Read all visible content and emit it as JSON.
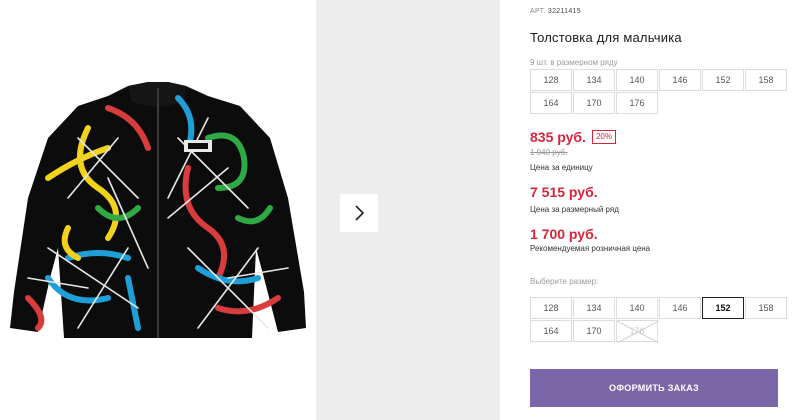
{
  "product": {
    "art_label": "АРТ.",
    "art_number": "32211415",
    "title": "Толстовка для мальчика",
    "pack_note": "9 шт. в размерном ряду",
    "pack_sizes": [
      "128",
      "134",
      "140",
      "146",
      "152",
      "158",
      "164",
      "170",
      "176"
    ]
  },
  "pricing": {
    "price": "835 руб.",
    "discount": "20%",
    "old_price": "1 040 руб.",
    "unit_caption": "Цена за единицу",
    "set_price": "7 515 руб.",
    "set_caption": "Цена за размерный ряд",
    "retail_price": "1 700 руб.",
    "retail_caption": "Рекомендуемая розничная цена"
  },
  "size_picker": {
    "label": "Выберите размер:",
    "sizes": [
      "128",
      "134",
      "140",
      "146",
      "152",
      "158",
      "164",
      "170",
      "176"
    ],
    "selected": "152",
    "unavailable": "176"
  },
  "actions": {
    "order_label": "ОФОРМИТЬ ЗАКАЗ"
  },
  "colors": {
    "accent_red": "#d6243a",
    "button_purple": "#7b66a8"
  },
  "icons": {
    "next": "chevron-right-icon"
  }
}
